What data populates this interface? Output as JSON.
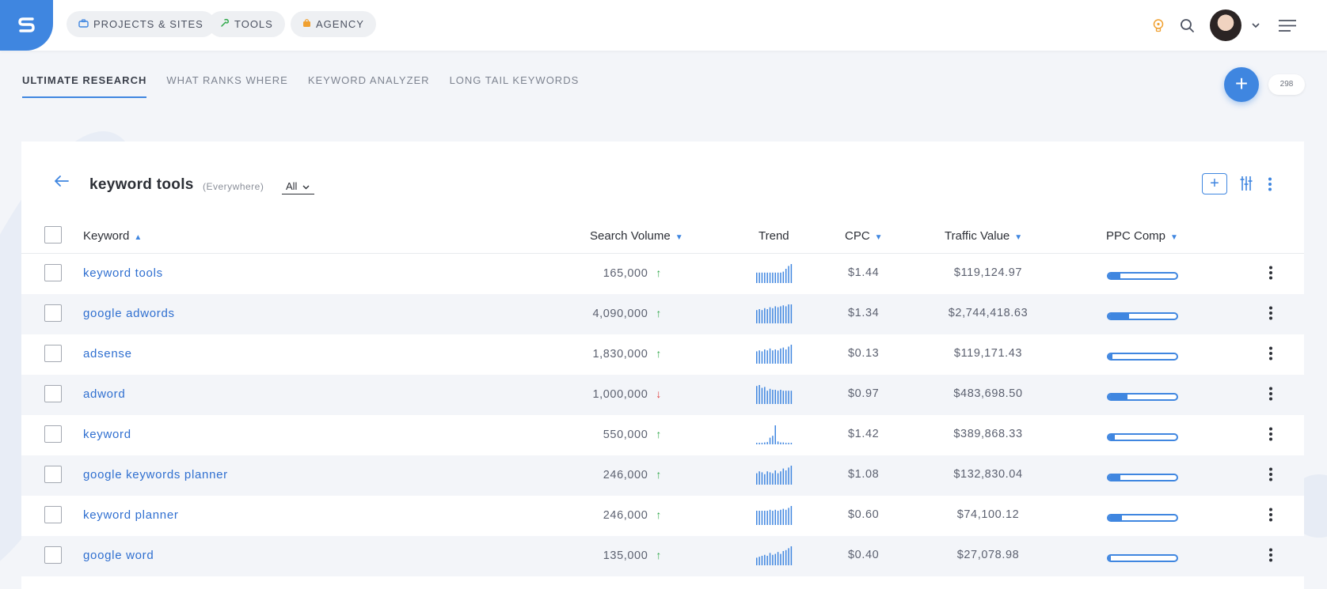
{
  "colors": {
    "accent": "#3f86e0",
    "up": "#2fa84a",
    "down": "#e03c3c"
  },
  "header": {
    "nav": [
      {
        "label": "PROJECTS & SITES",
        "icon": "briefcase-icon"
      },
      {
        "label": "TOOLS",
        "icon": "tools-icon"
      },
      {
        "label": "AGENCY",
        "icon": "bag-icon"
      }
    ],
    "icons": [
      "lightbulb-icon",
      "search-icon",
      "avatar",
      "chevron-down-icon",
      "menu-icon"
    ]
  },
  "tabs": [
    {
      "label": "ULTIMATE RESEARCH",
      "active": true
    },
    {
      "label": "WHAT RANKS WHERE",
      "active": false
    },
    {
      "label": "KEYWORD ANALYZER",
      "active": false
    },
    {
      "label": "LONG TAIL KEYWORDS",
      "active": false
    }
  ],
  "fab": {
    "label": "+",
    "count": "298"
  },
  "research": {
    "keyword": "keyword tools",
    "scope": "(Everywhere)",
    "filter": "All"
  },
  "table": {
    "columns": {
      "keyword": "Keyword",
      "volume": "Search Volume",
      "trend": "Trend",
      "cpc": "CPC",
      "traffic": "Traffic Value",
      "ppc": "PPC Comp"
    },
    "rows": [
      {
        "keyword": "keyword tools",
        "volume": "165,000",
        "dir": "up",
        "cpc": "$1.44",
        "traffic": "$119,124.97",
        "ppc": 0.17,
        "trend": [
          0.55,
          0.55,
          0.55,
          0.55,
          0.55,
          0.55,
          0.55,
          0.55,
          0.55,
          0.55,
          0.6,
          0.75,
          0.9,
          1.0
        ]
      },
      {
        "keyword": "google adwords",
        "volume": "4,090,000",
        "dir": "up",
        "cpc": "$1.34",
        "traffic": "$2,744,418.63",
        "ppc": 0.3,
        "trend": [
          0.7,
          0.75,
          0.7,
          0.8,
          0.75,
          0.85,
          0.8,
          0.9,
          0.85,
          0.9,
          0.95,
          0.9,
          1.0,
          1.0
        ]
      },
      {
        "keyword": "adsense",
        "volume": "1,830,000",
        "dir": "up",
        "cpc": "$0.13",
        "traffic": "$119,171.43",
        "ppc": 0.06,
        "trend": [
          0.65,
          0.7,
          0.65,
          0.75,
          0.7,
          0.8,
          0.7,
          0.75,
          0.7,
          0.8,
          0.85,
          0.75,
          0.9,
          1.0
        ]
      },
      {
        "keyword": "adword",
        "volume": "1,000,000",
        "dir": "down",
        "cpc": "$0.97",
        "traffic": "$483,698.50",
        "ppc": 0.28,
        "trend": [
          0.95,
          1.0,
          0.85,
          0.9,
          0.7,
          0.8,
          0.75,
          0.75,
          0.7,
          0.75,
          0.7,
          0.7,
          0.7,
          0.7
        ]
      },
      {
        "keyword": "keyword",
        "volume": "550,000",
        "dir": "up",
        "cpc": "$1.42",
        "traffic": "$389,868.33",
        "ppc": 0.09,
        "trend": [
          0.08,
          0.08,
          0.08,
          0.1,
          0.12,
          0.35,
          0.45,
          1.0,
          0.15,
          0.1,
          0.1,
          0.08,
          0.08,
          0.08
        ]
      },
      {
        "keyword": "google keywords planner",
        "volume": "246,000",
        "dir": "up",
        "cpc": "$1.08",
        "traffic": "$132,830.04",
        "ppc": 0.18,
        "trend": [
          0.6,
          0.7,
          0.65,
          0.55,
          0.7,
          0.65,
          0.6,
          0.75,
          0.6,
          0.7,
          0.85,
          0.75,
          0.9,
          1.0
        ]
      },
      {
        "keyword": "keyword planner",
        "volume": "246,000",
        "dir": "up",
        "cpc": "$0.60",
        "traffic": "$74,100.12",
        "ppc": 0.2,
        "trend": [
          0.75,
          0.75,
          0.75,
          0.75,
          0.75,
          0.8,
          0.75,
          0.8,
          0.75,
          0.8,
          0.85,
          0.8,
          0.9,
          1.0
        ]
      },
      {
        "keyword": "google word",
        "volume": "135,000",
        "dir": "up",
        "cpc": "$0.40",
        "traffic": "$27,078.98",
        "ppc": 0.03,
        "trend": [
          0.4,
          0.45,
          0.5,
          0.55,
          0.5,
          0.65,
          0.55,
          0.6,
          0.7,
          0.6,
          0.75,
          0.8,
          0.9,
          1.0
        ]
      }
    ]
  }
}
